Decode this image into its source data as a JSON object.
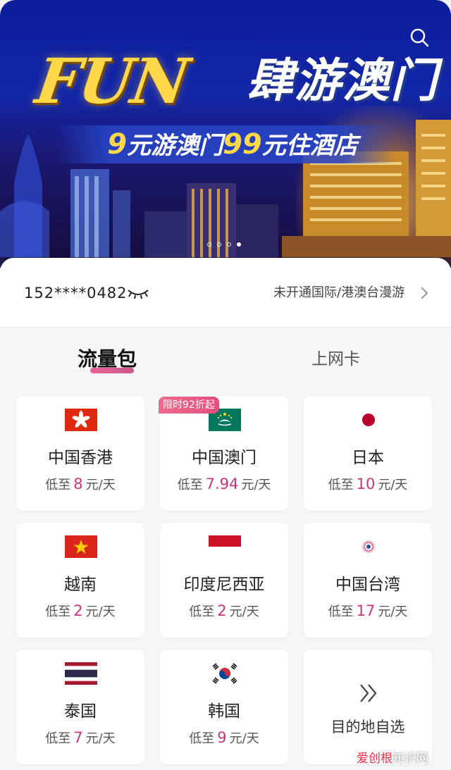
{
  "banner": {
    "title_fun": "FUN",
    "title_main": "肆游澳门",
    "subtitle_prefix_num": "9",
    "subtitle_mid": "元游澳门",
    "subtitle_num2": "99",
    "subtitle_end": "元住酒店",
    "carousel_count": 4,
    "carousel_active": 4
  },
  "account": {
    "phone": "152****0482",
    "roaming_link": "未开通国际/港澳台漫游"
  },
  "tabs": {
    "active": "流量包",
    "inactive": "上网卡"
  },
  "promo_badge": "限时92折起",
  "price_prefix": "低至",
  "price_suffix": "元/天",
  "destinations": [
    {
      "name": "中国香港",
      "price": "8",
      "flag": "hongkong-flag-icon"
    },
    {
      "name": "中国澳门",
      "price": "7.94",
      "flag": "macau-flag-icon"
    },
    {
      "name": "日本",
      "price": "10",
      "flag": "japan-flag-icon"
    },
    {
      "name": "越南",
      "price": "2",
      "flag": "vietnam-flag-icon"
    },
    {
      "name": "印度尼西亚",
      "price": "2",
      "flag": "indonesia-flag-icon"
    },
    {
      "name": "中国台湾",
      "price": "17",
      "flag": "taiwan-emblem-icon"
    },
    {
      "name": "泰国",
      "price": "7",
      "flag": "thailand-flag-icon"
    },
    {
      "name": "韩国",
      "price": "9",
      "flag": "korea-flag-icon"
    }
  ],
  "custom_destination": {
    "label": "目的地自选",
    "icon": "double-chevron-right-icon"
  },
  "watermark": {
    "part1": "爱创根",
    "part2": "知识网"
  },
  "colors": {
    "accent": "#c9357c",
    "promo": "#e24f7c"
  }
}
